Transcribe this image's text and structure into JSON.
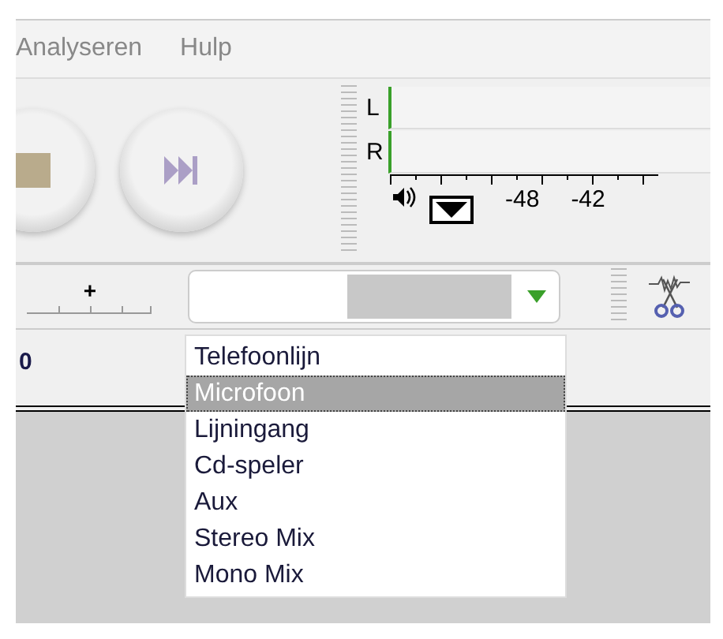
{
  "menu_bar": {
    "items": [
      {
        "label": "Analyseren"
      },
      {
        "label": "Hulp"
      }
    ]
  },
  "transport": {
    "buttons": [
      {
        "kind": "stop"
      },
      {
        "kind": "skip-end"
      }
    ]
  },
  "meter": {
    "channels": [
      {
        "label": "L",
        "level": 0
      },
      {
        "label": "R",
        "level": 0
      }
    ],
    "scale": [
      "-48",
      "-42"
    ]
  },
  "mixer": {
    "slider_mark": "+"
  },
  "input_select": {
    "options": [
      {
        "label": "Telefoonlijn",
        "selected": false
      },
      {
        "label": "Microfoon",
        "selected": true
      },
      {
        "label": "Lijningang",
        "selected": false
      },
      {
        "label": "Cd-speler",
        "selected": false
      },
      {
        "label": "Aux",
        "selected": false
      },
      {
        "label": "Stereo Mix",
        "selected": false
      },
      {
        "label": "Mono Mix",
        "selected": false
      }
    ]
  },
  "timeline": {
    "label": "0"
  }
}
